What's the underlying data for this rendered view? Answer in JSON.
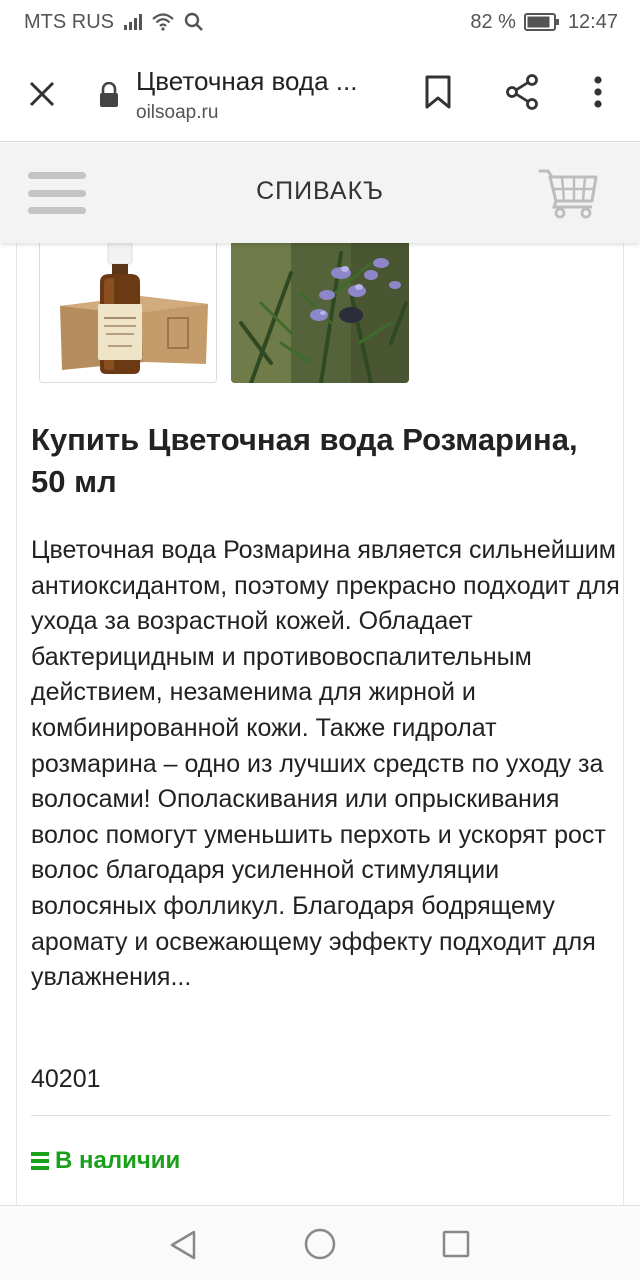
{
  "status": {
    "carrier": "MTS RUS",
    "battery": "82 %",
    "time": "12:47"
  },
  "tab": {
    "title": "Цветочная вода ...",
    "url": "oilsoap.ru"
  },
  "site": {
    "brand": "СПИВАКЪ"
  },
  "product": {
    "title": "Купить Цветочная вода Розмарина, 50 мл",
    "description": "Цветочная вода Розмарина является сильнейшим антиоксидантом, поэтому прекрасно подходит для ухода за возрастной кожей. Обладает бактерицидным и противовоспалительным действием, незаменима для жирной и комбинированной кожи. Также гидролат розмарина – одно из лучших средств по уходу за волосами! Ополаскивания или опрыскивания волос помогут уменьшить перхоть и ускорят рост волос благодаря усиленной стимуляции волосяных фолликул. Благодаря бодрящему аромату и освежающему эффекту подходит для увлажнения...",
    "sku": "40201",
    "stock": "В наличии"
  },
  "colors": {
    "accent_green": "#1aa01a",
    "header_bg": "#f3f3f3"
  },
  "icons": {
    "close": "close-icon",
    "lock": "lock-icon",
    "bookmark": "bookmark-icon",
    "share": "share-icon",
    "menu": "more-vert-icon",
    "hamburger": "hamburger-icon",
    "cart": "cart-icon",
    "stock": "list-icon",
    "back": "back-triangle-icon",
    "home": "home-circle-icon",
    "recent": "recent-square-icon"
  }
}
